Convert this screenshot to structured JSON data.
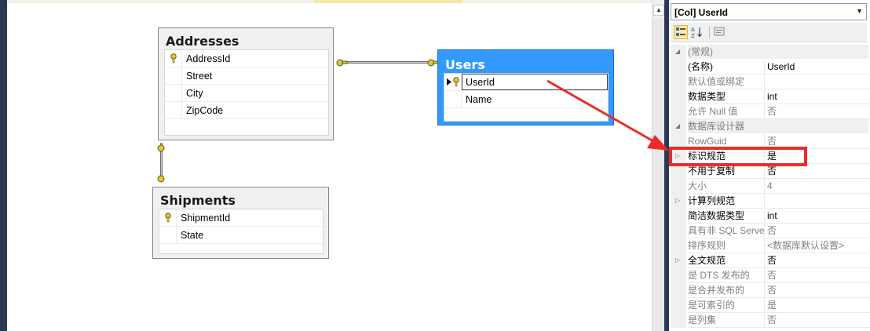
{
  "diagram": {
    "tables": [
      {
        "id": "addresses",
        "title": "Addresses",
        "columns": [
          {
            "name": "AddressId",
            "primary_key": true
          },
          {
            "name": "Street",
            "primary_key": false
          },
          {
            "name": "City",
            "primary_key": false
          },
          {
            "name": "ZipCode",
            "primary_key": false
          }
        ]
      },
      {
        "id": "users",
        "title": "Users",
        "selected": true,
        "columns": [
          {
            "name": "UserId",
            "primary_key": true,
            "active": true
          },
          {
            "name": "Name",
            "primary_key": false
          }
        ]
      },
      {
        "id": "shipments",
        "title": "Shipments",
        "columns": [
          {
            "name": "ShipmentId",
            "primary_key": true
          },
          {
            "name": "State",
            "primary_key": false
          }
        ]
      }
    ],
    "relationships": [
      {
        "from": "addresses",
        "to": "users"
      },
      {
        "from": "addresses",
        "to": "shipments"
      }
    ]
  },
  "properties": {
    "object_selector": "[Col] UserId",
    "toolbar": {
      "categorized": "categorized-icon",
      "alphabetical": "alphabetical-icon",
      "pages": "property-pages-icon"
    },
    "rows": [
      {
        "type": "category",
        "name": "(常规)"
      },
      {
        "type": "prop",
        "name": "(名称)",
        "value": "UserId"
      },
      {
        "type": "prop",
        "name": "默认值或绑定",
        "value": "",
        "readonly": true
      },
      {
        "type": "prop",
        "name": "数据类型",
        "value": "int"
      },
      {
        "type": "prop",
        "name": "允许 Null 值",
        "value": "否",
        "readonly": true
      },
      {
        "type": "category",
        "name": "数据库设计器"
      },
      {
        "type": "prop",
        "name": "RowGuid",
        "value": "否",
        "readonly": true
      },
      {
        "type": "prop",
        "name": "标识规范",
        "value": "是",
        "expandable": true
      },
      {
        "type": "prop",
        "name": "不用于复制",
        "value": "否"
      },
      {
        "type": "prop",
        "name": "大小",
        "value": "4",
        "readonly": true
      },
      {
        "type": "prop",
        "name": "计算列规范",
        "value": "",
        "expandable": true
      },
      {
        "type": "prop",
        "name": "简洁数据类型",
        "value": "int"
      },
      {
        "type": "prop",
        "name": "具有非 SQL Server",
        "value": "否",
        "readonly": true
      },
      {
        "type": "prop",
        "name": "排序规则",
        "value": "<数据库默认设置>",
        "readonly": true
      },
      {
        "type": "prop",
        "name": "全文规范",
        "value": "否",
        "expandable": true
      },
      {
        "type": "prop",
        "name": "是 DTS 发布的",
        "value": "否",
        "readonly": true
      },
      {
        "type": "prop",
        "name": "是合并发布的",
        "value": "否",
        "readonly": true
      },
      {
        "type": "prop",
        "name": "是可索引的",
        "value": "是",
        "readonly": true
      },
      {
        "type": "prop",
        "name": "是列集",
        "value": "否",
        "readonly": true
      }
    ],
    "highlighted_row": "标识规范",
    "annotation_color": "#ee2b2b"
  }
}
